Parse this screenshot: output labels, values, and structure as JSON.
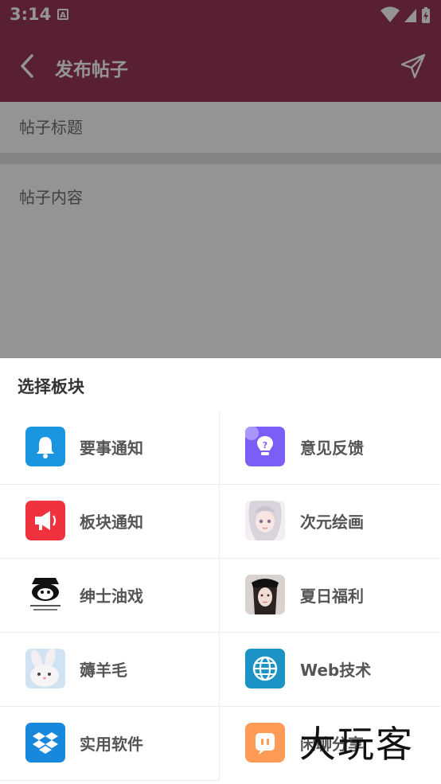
{
  "status_bar": {
    "time": "3:14",
    "notif_glyph": "A"
  },
  "toolbar": {
    "title": "发布帖子"
  },
  "form": {
    "title_placeholder": "帖子标题",
    "content_placeholder": "帖子内容"
  },
  "sheet": {
    "title": "选择板块",
    "items": [
      {
        "label": "要事通知",
        "icon": "bell-icon",
        "color": "#1a95e0"
      },
      {
        "label": "意见反馈",
        "icon": "lightbulb-question-icon",
        "color": "#7b5ef5"
      },
      {
        "label": "板块通知",
        "icon": "megaphone-icon",
        "color": "#f0323f"
      },
      {
        "label": "次元绘画",
        "icon": "anime-girl-thumbnail",
        "color": "#e8dde3"
      },
      {
        "label": "绅士油戏",
        "icon": "meme-panda-thumbnail",
        "color": "#ffffff"
      },
      {
        "label": "夏日福利",
        "icon": "girl-photo-thumbnail",
        "color": "#d9cfcc"
      },
      {
        "label": "薅羊毛",
        "icon": "rabbit-thumbnail",
        "color": "#cfe3f3"
      },
      {
        "label": "Web技术",
        "icon": "globe-icon",
        "color": "#1b93c4"
      },
      {
        "label": "实用软件",
        "icon": "dropbox-icon",
        "color": "#1888dd"
      },
      {
        "label": "闲聊分享",
        "icon": "chat-icon",
        "color": "#ff9a57"
      }
    ]
  },
  "watermark": "大玩客"
}
